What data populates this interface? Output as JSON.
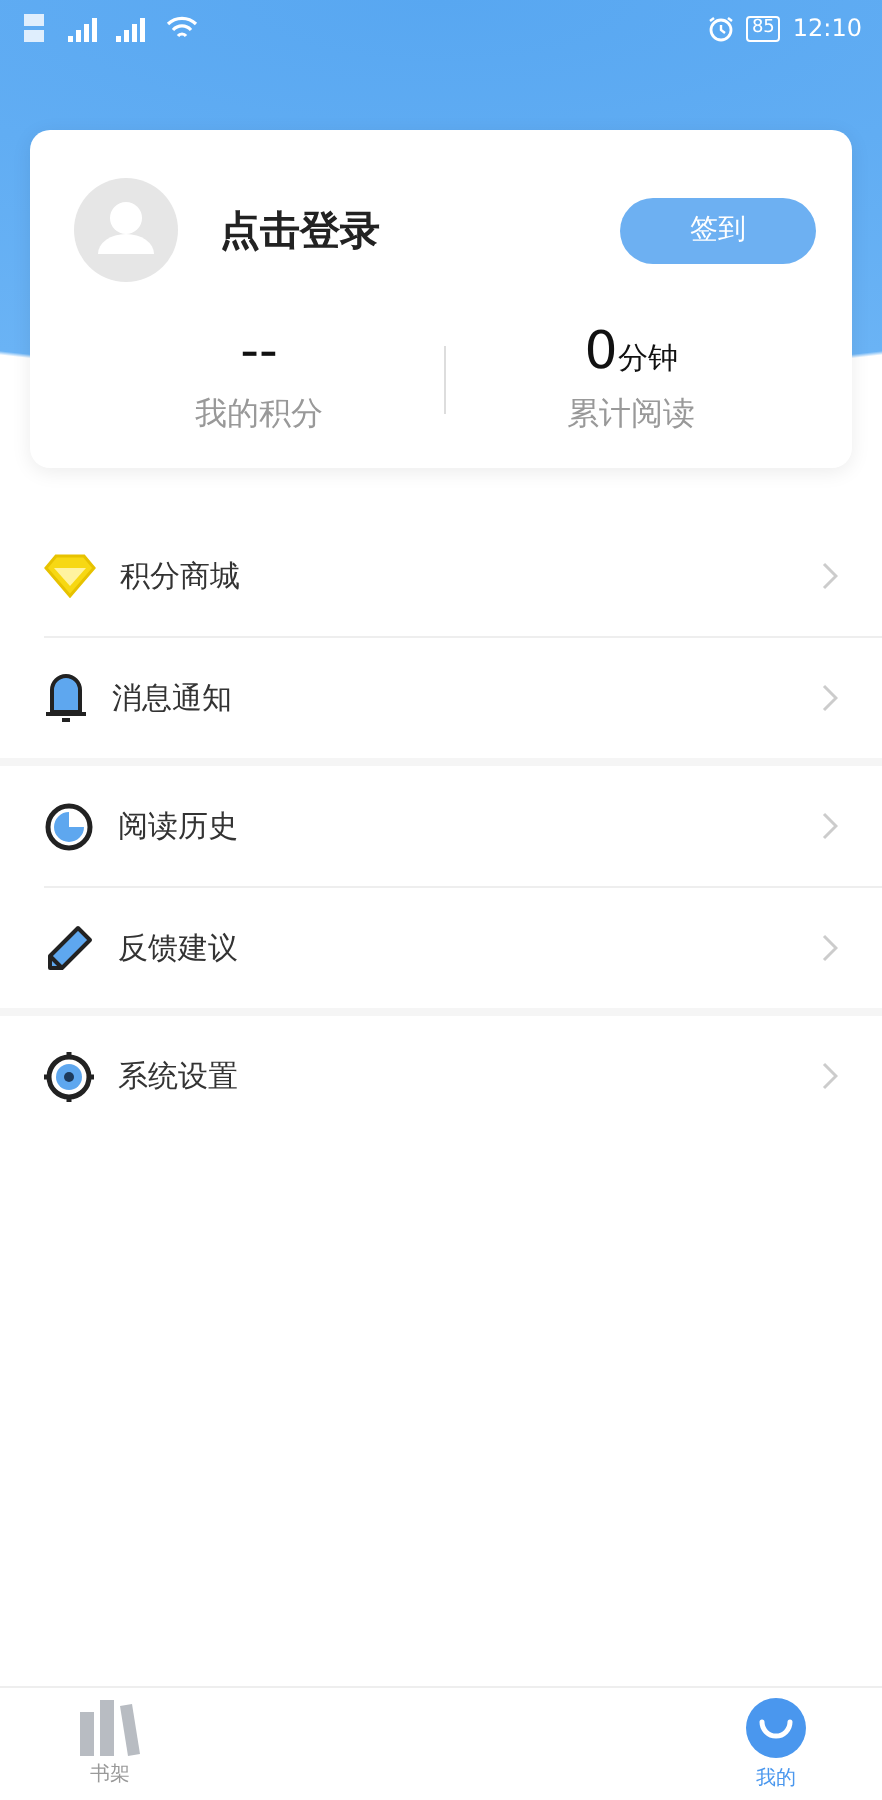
{
  "status_bar": {
    "battery": "85",
    "time": "12:10"
  },
  "profile": {
    "title": "点击登录",
    "sign_in_button": "签到"
  },
  "stats": [
    {
      "value": "--",
      "label": "我的积分"
    },
    {
      "value": "0",
      "unit": "分钟",
      "label": "累计阅读"
    }
  ],
  "menu_groups": [
    {
      "items": [
        {
          "kind": "diamond",
          "label": "积分商城"
        },
        {
          "kind": "bell",
          "label": "消息通知"
        }
      ]
    },
    {
      "items": [
        {
          "kind": "clock",
          "label": "阅读历史"
        },
        {
          "kind": "pencil",
          "label": "反馈建议"
        }
      ]
    },
    {
      "items": [
        {
          "kind": "gear",
          "label": "系统设置"
        }
      ]
    }
  ],
  "tab_bar": [
    {
      "kind": "bookshelf",
      "label": "书架",
      "selected": false
    },
    {
      "kind": "profile",
      "label": "我的",
      "selected": true
    }
  ]
}
